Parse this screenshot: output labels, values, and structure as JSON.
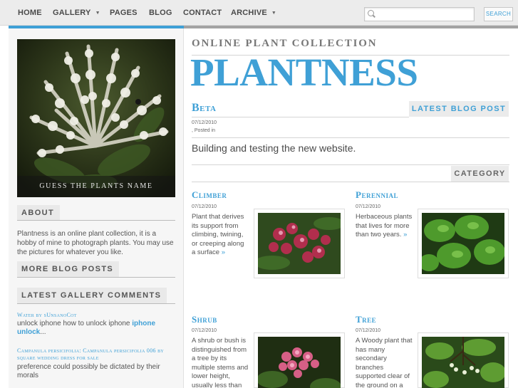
{
  "nav": {
    "items": [
      "HOME",
      "GALLERY",
      "PAGES",
      "BLOG",
      "CONTACT",
      "ARCHIVE"
    ],
    "search_button": "SEARCH",
    "search_placeholder": ""
  },
  "sidebar": {
    "photo_caption": "GUESS THE PLANTS NAME",
    "about_heading": "ABOUT",
    "about_text": "Plantness is an online plant collection, it is a hobby of mine to photograph plants. You may use the pictures for whatever you like.",
    "more_posts_heading": "MORE BLOG POSTS",
    "comments_heading": "LATEST GALLERY COMMENTS",
    "comments": [
      {
        "title": "Water by sUnsanoCot",
        "body": "unlock iphone how to unlock iphone ",
        "link1": "iphone",
        "link2": "unlock",
        "tail": "..."
      },
      {
        "title": "Campanula persicifolia: Campanula persicifolia 006 by square wedding dress for sale",
        "body": "preference could possibly be dictated by their morals"
      }
    ]
  },
  "header": {
    "subtitle": "ONLINE PLANT COLLECTION",
    "title": "PLANTNESS"
  },
  "latest_post": {
    "heading": "LATEST BLOG POST",
    "title": "Beta",
    "date": "07/12/2010",
    "posted": ", Posted in",
    "body": "Building and testing the new website."
  },
  "category": {
    "heading": "CATEGORY",
    "items": [
      {
        "title": "Climber",
        "date": "07/12/2010",
        "text": "Plant that derives its support from climbing, twining, or creeping along a surface",
        "more": "»",
        "image": "climber-photo"
      },
      {
        "title": "Perennial",
        "date": "07/12/2010",
        "text": "Herbaceous plants that lives for more than two years.",
        "more": "»",
        "image": "perennial-photo"
      },
      {
        "title": "Shrub",
        "date": "07/12/2010",
        "text": "A shrub or bush is distinguished from a tree by its multiple stems and lower height, usually less than",
        "more": "",
        "image": "shrub-photo"
      },
      {
        "title": "Tree",
        "date": "07/12/2010",
        "text": "A Woody plant that has many secondary branches supported clear of the ground on a",
        "more": "",
        "image": "tree-photo"
      }
    ]
  },
  "colors": {
    "accent": "#3fa0d6",
    "nav_bg": "#ececec",
    "sidebar_bg": "#f6f6f6"
  }
}
